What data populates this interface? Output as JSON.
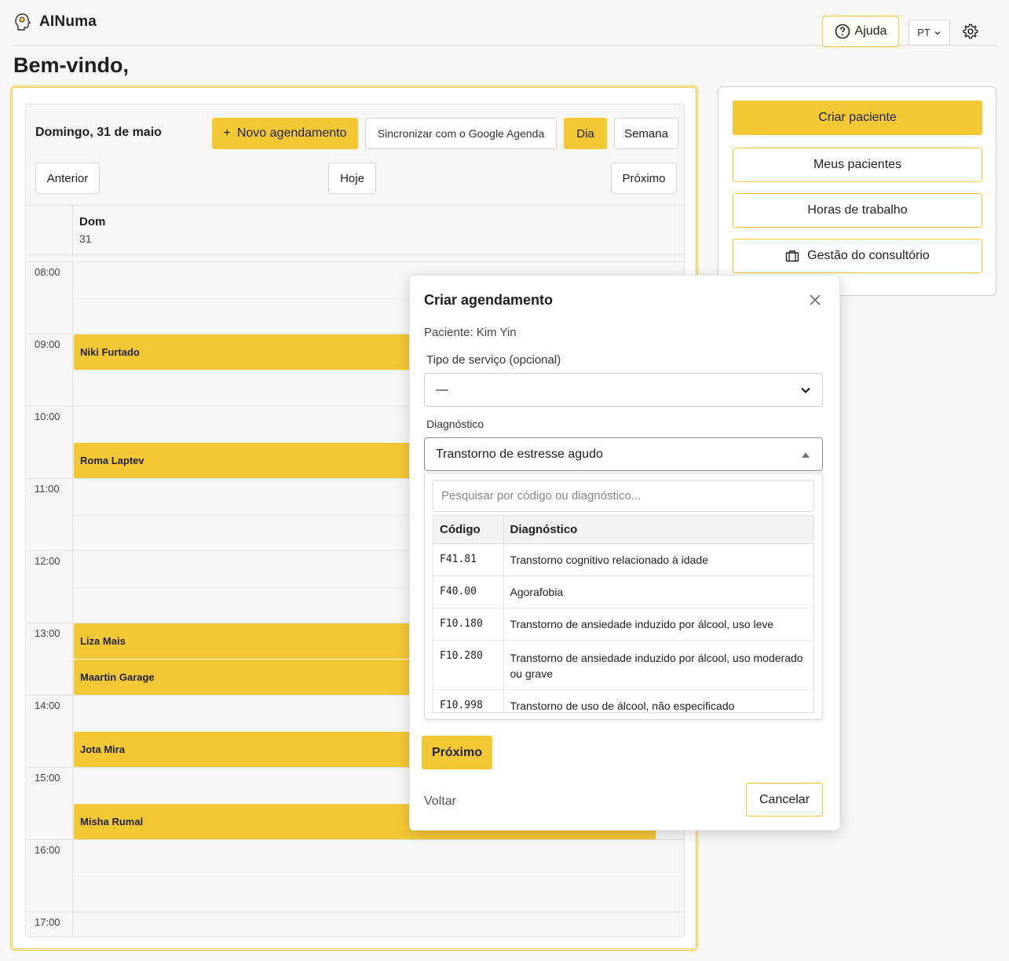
{
  "app": {
    "name": "AINuma"
  },
  "header": {
    "help_label": "Ajuda",
    "lang_label": "PT"
  },
  "page": {
    "welcome": "Bem-vindo,"
  },
  "calendar": {
    "date_label": "Domingo, 31 de maio",
    "new_appointment_label": "Novo agendamento",
    "new_appointment_prefix": "+",
    "sync_label": "Sincronizar com o Google Agenda",
    "day_label": "Dia",
    "week_label": "Semana",
    "prev_label": "Anterior",
    "today_label": "Hoje",
    "next_label": "Próximo",
    "day_name": "Dom",
    "day_number": "31",
    "hours": [
      "08:00",
      "09:00",
      "10:00",
      "11:00",
      "12:00",
      "13:00",
      "14:00",
      "15:00",
      "16:00",
      "17:00"
    ],
    "events": [
      {
        "name": "Niki Furtado",
        "start": "09:00",
        "end": "09:30"
      },
      {
        "name": "Roma Laptev",
        "start": "10:30",
        "end": "11:00"
      },
      {
        "name": "Liza Mais",
        "start": "13:00",
        "end": "13:30"
      },
      {
        "name": "Maartin Garage",
        "start": "13:30",
        "end": "14:00"
      },
      {
        "name": "Jota Mira",
        "start": "14:30",
        "end": "15:00"
      },
      {
        "name": "Misha Rumal",
        "start": "15:30",
        "end": "16:00"
      }
    ]
  },
  "side": {
    "create_patient": "Criar paciente",
    "my_patients": "Meus pacientes",
    "work_hours": "Horas de trabalho",
    "practice_mgmt": "Gestão do consultório"
  },
  "modal": {
    "title": "Criar agendamento",
    "patient": "Paciente: Kim Yin",
    "service_label": "Tipo de serviço (opcional)",
    "service_value": "—",
    "diagnosis_label": "Diagnóstico",
    "diagnosis_value": "Transtorno de estresse agudo",
    "search_placeholder": "Pesquisar por código ou diagnóstico...",
    "col_code": "Código",
    "col_diag": "Diagnóstico",
    "rows": [
      {
        "code": "F41.81",
        "desc": "Transtorno cognitivo relacionado à idade"
      },
      {
        "code": "F40.00",
        "desc": "Agorafobia"
      },
      {
        "code": "F10.180",
        "desc": "Transtorno de ansiedade induzido por álcool, uso leve"
      },
      {
        "code": "F10.280",
        "desc": "Transtorno de ansiedade induzido por álcool, uso moderado ou grave"
      },
      {
        "code": "F10.998",
        "desc": "Transtorno de uso de álcool, não especificado"
      }
    ],
    "next_label": "Próximo",
    "back_label": "Voltar",
    "cancel_label": "Cancelar"
  },
  "colors": {
    "accent": "#f4c834",
    "background": "#f7f7f7"
  }
}
